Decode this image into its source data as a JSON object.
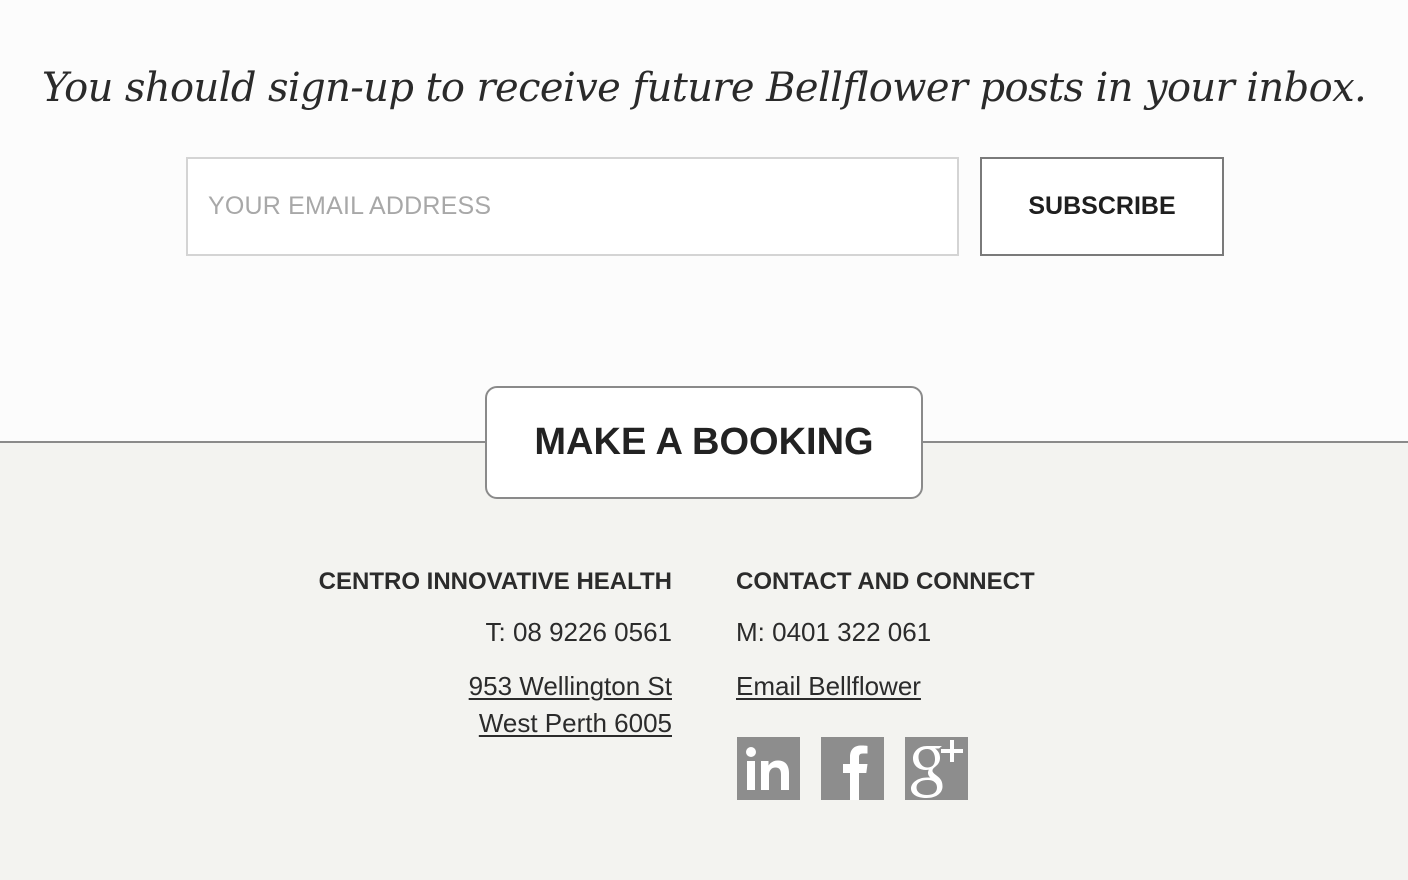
{
  "signup": {
    "heading": "You should sign-up to receive future Bellflower posts in your inbox.",
    "email_placeholder": "YOUR EMAIL ADDRESS",
    "email_value": "",
    "subscribe_label": "SUBSCRIBE"
  },
  "booking": {
    "label": "MAKE A BOOKING"
  },
  "footer": {
    "left": {
      "heading": "CENTRO INNOVATIVE HEALTH",
      "phone": "T: 08 9226 0561",
      "address_line1": "953 Wellington St",
      "address_line2": "West Perth 6005"
    },
    "right": {
      "heading": "CONTACT AND CONNECT",
      "mobile": "M: 0401 322 061",
      "email_link": "Email Bellflower"
    },
    "social": [
      {
        "name": "linkedin-icon",
        "glyph": "in"
      },
      {
        "name": "facebook-icon",
        "glyph": "f"
      },
      {
        "name": "google-plus-icon",
        "glyph": "g+"
      }
    ]
  },
  "colors": {
    "footer_background": "#f3f3f0",
    "page_background": "#fcfcfc",
    "icon_gray": "#8d8d8d",
    "text_dark": "#2b2b2b"
  }
}
